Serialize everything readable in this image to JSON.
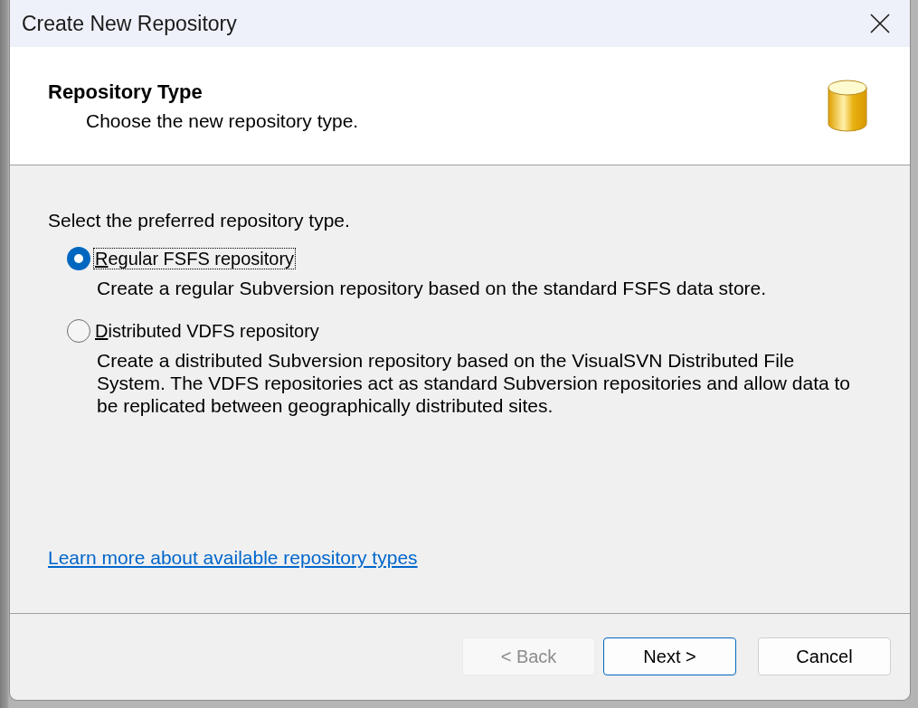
{
  "window": {
    "title": "Create New Repository"
  },
  "header": {
    "title": "Repository Type",
    "subtitle": "Choose the new repository type."
  },
  "prompt": "Select the preferred repository type.",
  "options": [
    {
      "label": "Regular FSFS repository",
      "description": "Create a regular Subversion repository based on the standard FSFS data store.",
      "selected": true,
      "focused": true
    },
    {
      "label": "Distributed VDFS repository",
      "description": "Create a distributed Subversion repository based on the VisualSVN Distributed File System. The VDFS repositories act as standard Subversion repositories and allow data to be replicated between geographically distributed sites.",
      "selected": false,
      "focused": false
    }
  ],
  "link": "Learn more about available repository types",
  "buttons": [
    {
      "label": "< Back",
      "disabled": true,
      "default": false
    },
    {
      "label": "Next >",
      "disabled": false,
      "default": true
    },
    {
      "label": "Cancel",
      "disabled": false,
      "default": false
    }
  ]
}
